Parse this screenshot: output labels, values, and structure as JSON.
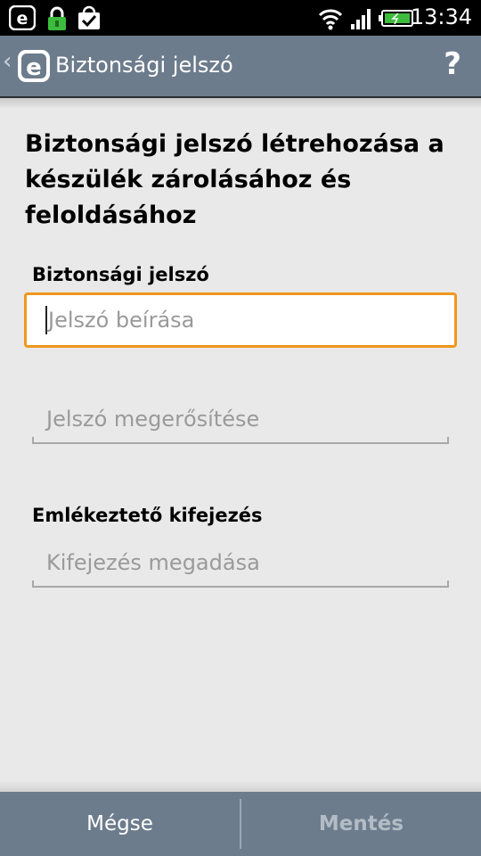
{
  "status_bar": {
    "time": "13:34",
    "icons": [
      "eset-notification-icon",
      "lock-icon",
      "shopping-bag-check-icon",
      "wifi-icon",
      "signal-icon",
      "battery-charging-icon"
    ]
  },
  "action_bar": {
    "title": "Biztonsági jelszó",
    "help_label": "?",
    "back_label": "‹"
  },
  "main": {
    "heading": "Biztonsági jelszó létrehozása a készülék zárolásához és feloldásához",
    "password_label": "Biztonsági jelszó",
    "password_placeholder": "Jelszó beírása",
    "confirm_placeholder": "Jelszó megerősítése",
    "hint_label": "Emlékeztető kifejezés",
    "hint_placeholder": "Kifejezés megadása"
  },
  "bottom_bar": {
    "cancel_label": "Mégse",
    "save_label": "Mentés"
  },
  "colors": {
    "action_bar": "#6d7c8c",
    "focus_border": "#f0971e",
    "background": "#e9e9e9"
  }
}
